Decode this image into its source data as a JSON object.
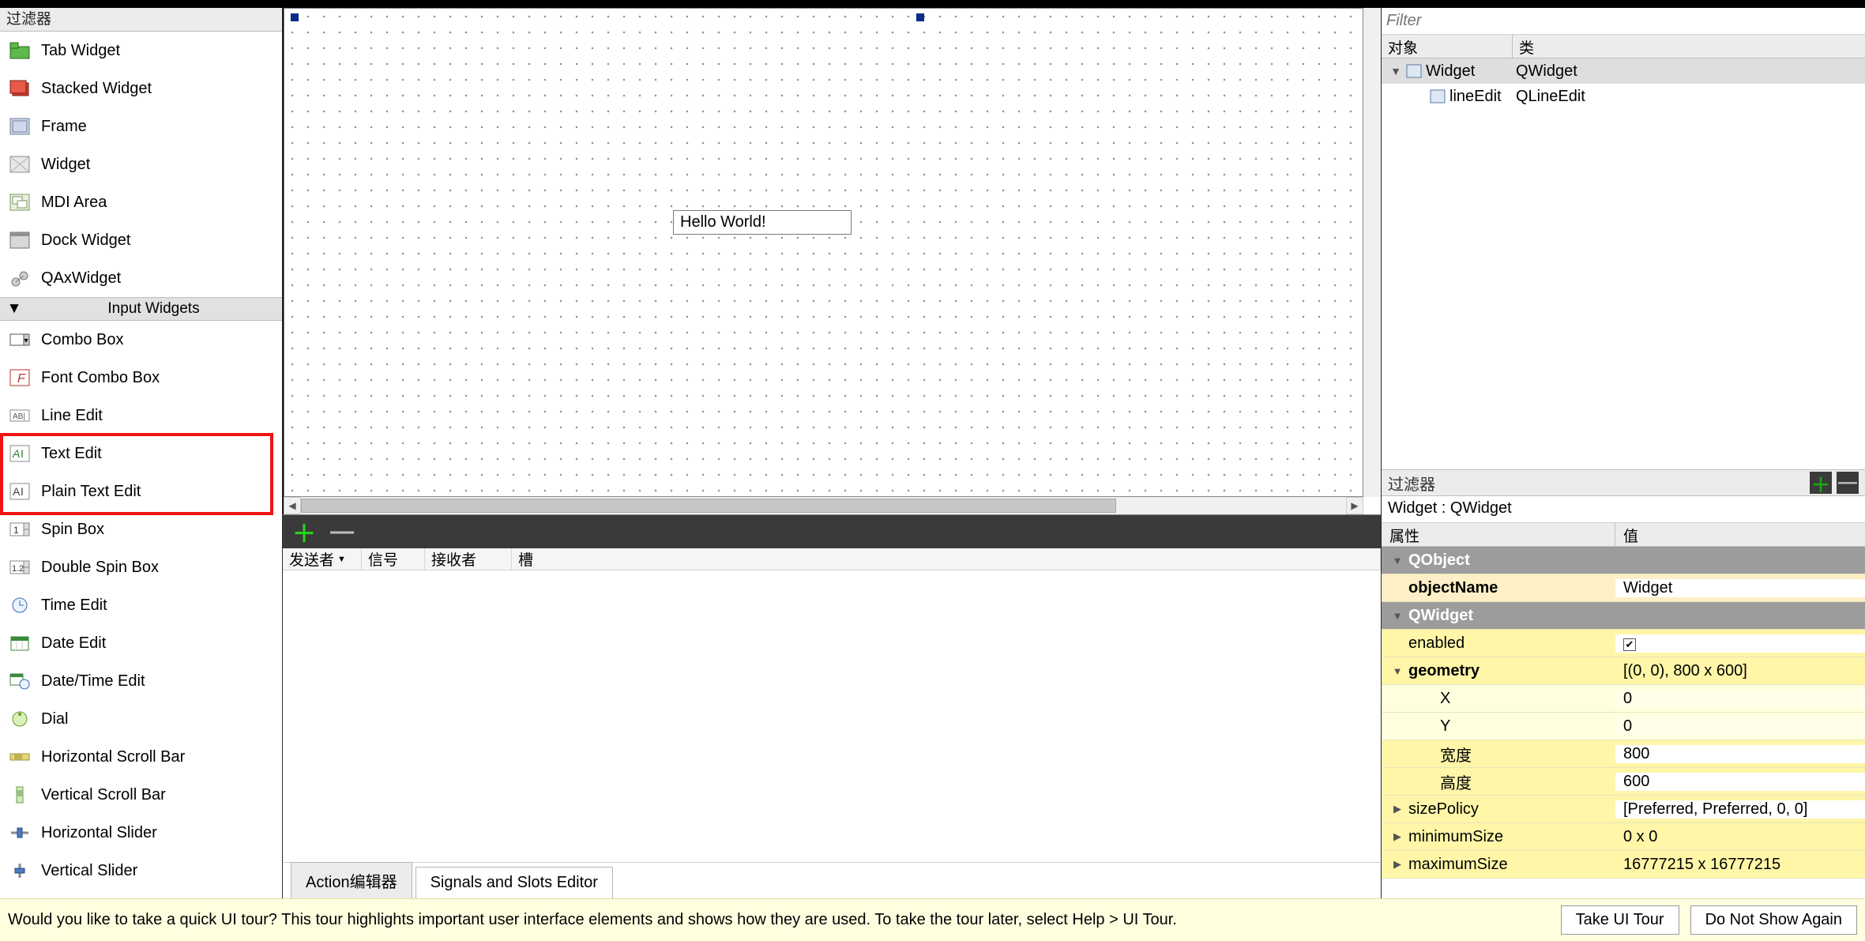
{
  "widget_box": {
    "filter_label": "过滤器",
    "items_top": [
      {
        "label": "Tab Widget"
      },
      {
        "label": "Stacked Widget"
      },
      {
        "label": "Frame"
      },
      {
        "label": "Widget"
      },
      {
        "label": "MDI Area"
      },
      {
        "label": "Dock Widget"
      },
      {
        "label": "QAxWidget"
      }
    ],
    "category": "Input Widgets",
    "items_input": [
      {
        "label": "Combo Box"
      },
      {
        "label": "Font Combo Box"
      },
      {
        "label": "Line Edit"
      },
      {
        "label": "Text Edit"
      },
      {
        "label": "Plain Text Edit"
      },
      {
        "label": "Spin Box"
      },
      {
        "label": "Double Spin Box"
      },
      {
        "label": "Time Edit"
      },
      {
        "label": "Date Edit"
      },
      {
        "label": "Date/Time Edit"
      },
      {
        "label": "Dial"
      },
      {
        "label": "Horizontal Scroll Bar"
      },
      {
        "label": "Vertical Scroll Bar"
      },
      {
        "label": "Horizontal Slider"
      },
      {
        "label": "Vertical Slider"
      }
    ]
  },
  "canvas": {
    "line_edit_value": "Hello World!"
  },
  "signals_editor": {
    "headers": {
      "sender": "发送者",
      "signal": "信号",
      "receiver": "接收者",
      "slot": "槽"
    },
    "tabs": {
      "action": "Action编辑器",
      "signals": "Signals and Slots Editor"
    }
  },
  "object_inspector": {
    "filter_placeholder": "Filter",
    "headers": {
      "object": "对象",
      "class": "类"
    },
    "tree": [
      {
        "name": "Widget",
        "class": "QWidget",
        "level": 0,
        "expanded": true,
        "selected": true
      },
      {
        "name": "lineEdit",
        "class": "QLineEdit",
        "level": 1,
        "expanded": false,
        "selected": false
      }
    ]
  },
  "property_editor": {
    "filter_label": "过滤器",
    "title": "Widget : QWidget",
    "headers": {
      "name": "属性",
      "value": "值"
    },
    "rows": [
      {
        "type": "group",
        "label": "QObject"
      },
      {
        "type": "prop",
        "name": "objectName",
        "value": "Widget",
        "style": "cream",
        "bold": true
      },
      {
        "type": "group",
        "label": "QWidget"
      },
      {
        "type": "prop",
        "name": "enabled",
        "value": "check",
        "style": "yellow"
      },
      {
        "type": "prop",
        "name": "geometry",
        "value": "[(0, 0), 800 x 600]",
        "style": "yellow",
        "bold": true,
        "full": true,
        "expander": "down"
      },
      {
        "type": "sub",
        "name": "X",
        "value": "0",
        "style": "lightyellow"
      },
      {
        "type": "sub",
        "name": "Y",
        "value": "0",
        "style": "lightyellow"
      },
      {
        "type": "sub",
        "name": "宽度",
        "value": "800",
        "style": "yellow"
      },
      {
        "type": "sub",
        "name": "高度",
        "value": "600",
        "style": "yellow"
      },
      {
        "type": "prop",
        "name": "sizePolicy",
        "value": "[Preferred, Preferred, 0, 0]",
        "style": "yellow",
        "expander": "right"
      },
      {
        "type": "prop",
        "name": "minimumSize",
        "value": "0 x 0",
        "style": "yellow",
        "full": true,
        "expander": "right"
      },
      {
        "type": "prop",
        "name": "maximumSize",
        "value": "16777215 x 16777215",
        "style": "yellow",
        "full": true,
        "expander": "right"
      }
    ]
  },
  "tour": {
    "message": "Would you like to take a quick UI tour? This tour highlights important user interface elements and shows how they are used. To take the tour later, select Help > UI Tour.",
    "take": "Take UI Tour",
    "dont": "Do Not Show Again"
  }
}
